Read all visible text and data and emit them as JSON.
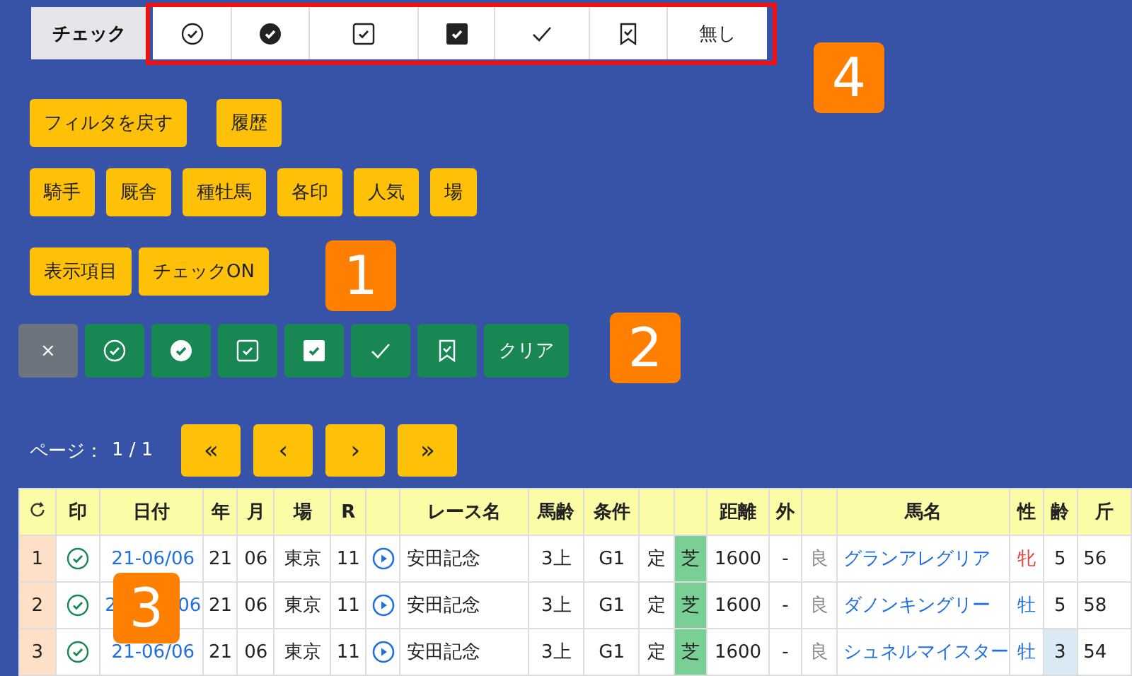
{
  "check_filter": {
    "label": "チェック",
    "options": [
      {
        "kind": "circle-check"
      },
      {
        "kind": "circle-check-filled"
      },
      {
        "kind": "square-check"
      },
      {
        "kind": "square-check-filled"
      },
      {
        "kind": "check"
      },
      {
        "kind": "bookmark-check"
      },
      {
        "kind": "text",
        "label": "無し"
      }
    ]
  },
  "filter_buttons": [
    {
      "label": "フィルタを戻す"
    },
    {
      "label": "履歴"
    }
  ],
  "group_buttons": [
    {
      "label": "騎手"
    },
    {
      "label": "厩舎"
    },
    {
      "label": "種牡馬"
    },
    {
      "label": "各印"
    },
    {
      "label": "人気"
    },
    {
      "label": "場"
    }
  ],
  "view_buttons": [
    {
      "label": "表示項目"
    },
    {
      "label": "チェックON"
    }
  ],
  "mark_buttons": [
    {
      "kind": "text",
      "label": "×",
      "color": "#6c757d"
    },
    {
      "kind": "circle-check",
      "color": "#198754"
    },
    {
      "kind": "circle-check-filled",
      "color": "#198754"
    },
    {
      "kind": "square-check",
      "color": "#198754"
    },
    {
      "kind": "square-check-filled",
      "color": "#198754"
    },
    {
      "kind": "check",
      "color": "#198754"
    },
    {
      "kind": "bookmark-check",
      "color": "#198754"
    },
    {
      "kind": "text",
      "label": "クリア",
      "color": "#198754"
    }
  ],
  "pagination": {
    "label": "ページ：",
    "page": "1 / 1",
    "buttons": [
      {
        "label": "«"
      },
      {
        "label": "‹"
      },
      {
        "label": "›"
      },
      {
        "label": "»"
      }
    ]
  },
  "table": {
    "columns": [
      {
        "kind": "refresh-icon"
      },
      {
        "label": "印"
      },
      {
        "label": "日付"
      },
      {
        "label": "年"
      },
      {
        "label": "月"
      },
      {
        "label": "場"
      },
      {
        "label": "R"
      },
      {
        "kind": "blank"
      },
      {
        "label": "レース名"
      },
      {
        "label": "馬齢"
      },
      {
        "label": "条件"
      },
      {
        "kind": "blank"
      },
      {
        "kind": "blank"
      },
      {
        "label": "距離"
      },
      {
        "label": "外"
      },
      {
        "kind": "blank"
      },
      {
        "label": "馬名"
      },
      {
        "label": "性"
      },
      {
        "label": "齢"
      },
      {
        "label": "斤"
      }
    ],
    "rows": [
      {
        "no": "1",
        "date": [
          "21-06/06"
        ],
        "year": "21",
        "month": "06",
        "venue": "東京",
        "race": "11",
        "race_name": "安田記念",
        "age_cond": "3上",
        "grade": "G1",
        "weight_rule": "定",
        "surface": "芝",
        "distance": "1600",
        "outer": "-",
        "going": "良",
        "horse": "グランアレグリア",
        "sex": "牝",
        "female": true,
        "age": "5",
        "age_highlight": false,
        "weight": "56"
      },
      {
        "no": "2",
        "date": [
          "2",
          "06"
        ],
        "year": "21",
        "month": "06",
        "venue": "東京",
        "race": "11",
        "race_name": "安田記念",
        "age_cond": "3上",
        "grade": "G1",
        "weight_rule": "定",
        "surface": "芝",
        "distance": "1600",
        "outer": "-",
        "going": "良",
        "horse": "ダノンキングリー",
        "sex": "牡",
        "female": false,
        "age": "5",
        "age_highlight": false,
        "weight": "58"
      },
      {
        "no": "3",
        "date": [
          "21-06/06"
        ],
        "year": "21",
        "month": "06",
        "venue": "東京",
        "race": "11",
        "race_name": "安田記念",
        "age_cond": "3上",
        "grade": "G1",
        "weight_rule": "定",
        "surface": "芝",
        "distance": "1600",
        "outer": "-",
        "going": "良",
        "horse": "シュネルマイスター",
        "sex": "牡",
        "female": false,
        "age": "3",
        "age_highlight": true,
        "weight": "54"
      }
    ]
  },
  "callouts": [
    {
      "label": "4"
    },
    {
      "label": "1"
    },
    {
      "label": "2"
    },
    {
      "label": "3"
    }
  ]
}
